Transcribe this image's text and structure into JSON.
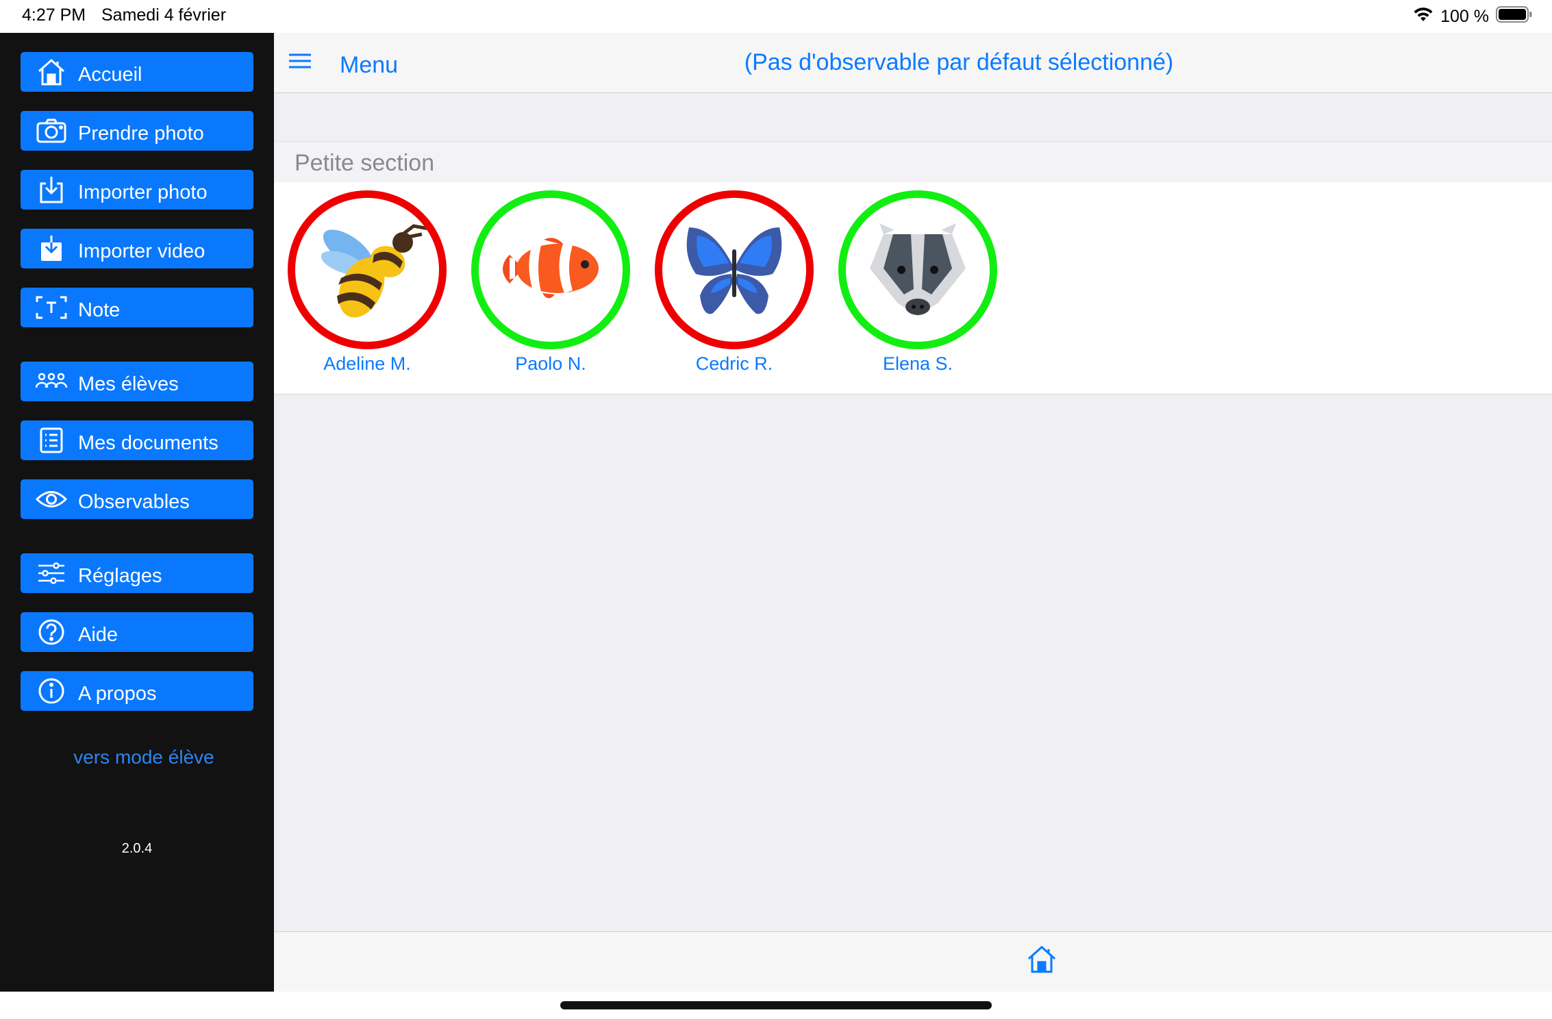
{
  "status_bar": {
    "time": "4:27 PM",
    "date": "Samedi 4 février",
    "battery": "100 %"
  },
  "sidebar": {
    "items": [
      {
        "label": "Accueil",
        "icon": "house-icon"
      },
      {
        "label": "Prendre photo",
        "icon": "camera-icon"
      },
      {
        "label": "Importer photo",
        "icon": "import-photo-icon"
      },
      {
        "label": "Importer video",
        "icon": "import-video-icon"
      },
      {
        "label": "Note",
        "icon": "text-note-icon"
      },
      {
        "label": "Mes élèves",
        "icon": "students-icon"
      },
      {
        "label": "Mes documents",
        "icon": "documents-icon"
      },
      {
        "label": "Observables",
        "icon": "eye-icon"
      },
      {
        "label": "Réglages",
        "icon": "sliders-icon"
      },
      {
        "label": "Aide",
        "icon": "help-icon"
      },
      {
        "label": "A propos",
        "icon": "info-icon"
      }
    ],
    "student_mode_link": "vers mode élève",
    "version": "2.0.4"
  },
  "navbar": {
    "menu_label": "Menu",
    "title": "(Pas d'observable par défaut sélectionné)"
  },
  "section": {
    "title": "Petite section",
    "students": [
      {
        "name": "Adeline M.",
        "animal": "bee-icon",
        "ring_color": "#ee0000"
      },
      {
        "name": "Paolo N.",
        "animal": "clownfish-icon",
        "ring_color": "#12ee12"
      },
      {
        "name": "Cedric R.",
        "animal": "butterfly-icon",
        "ring_color": "#ee0000"
      },
      {
        "name": "Elena S.",
        "animal": "badger-icon",
        "ring_color": "#12ee12"
      }
    ]
  },
  "toolbar": {
    "home_icon": "house-icon"
  },
  "colors": {
    "accent": "#0a7aff",
    "sidebar_button": "#0a78fd",
    "sidebar_bg": "#121212",
    "ring_red": "#ee0000",
    "ring_green": "#12ee12"
  }
}
